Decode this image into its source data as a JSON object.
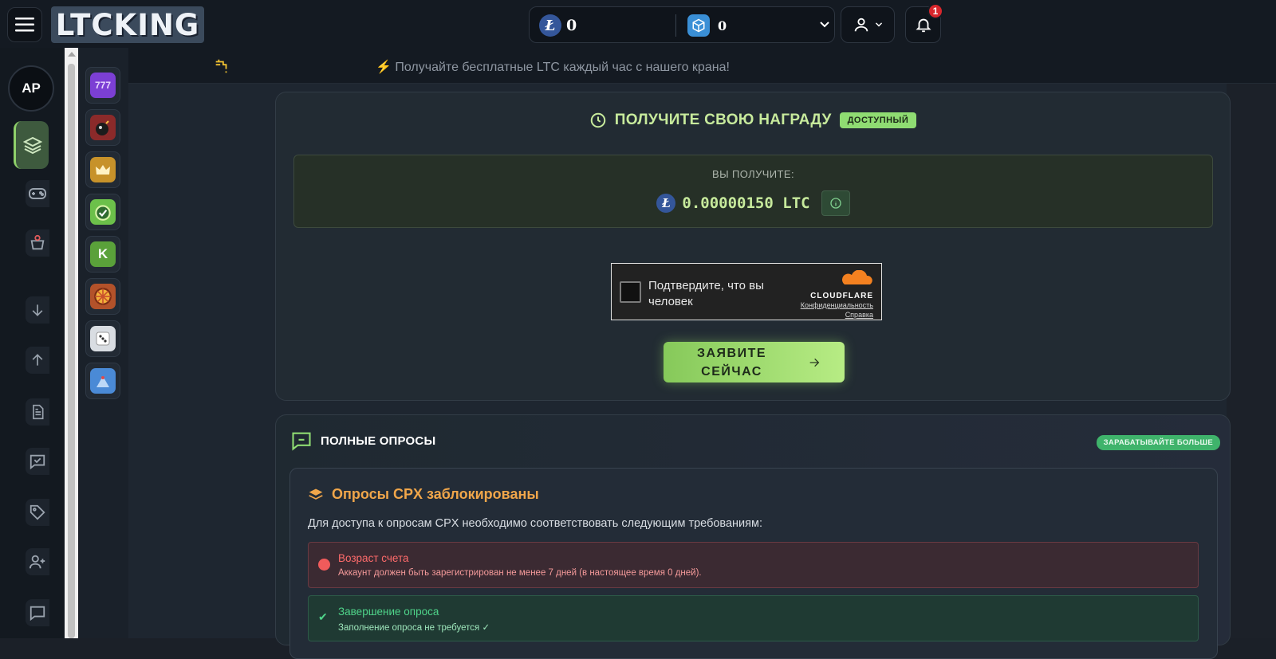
{
  "header": {
    "logo_text": "LTCKING",
    "ltc_balance": "0",
    "box_balance": "0",
    "notification_count": "1"
  },
  "sidebar": {
    "avatar_initials": "AP",
    "items": [
      "layers-icon",
      "gamepad-icon",
      "basket-icon",
      "deposit-icon",
      "withdraw-icon",
      "document-icon",
      "survey-icon",
      "tag-icon",
      "add-user-icon",
      "chat-icon"
    ]
  },
  "games": [
    {
      "name": "slots-777",
      "label": "777",
      "color": "#7c3fd4"
    },
    {
      "name": "mines",
      "label": "",
      "color": "#8b2a2a"
    },
    {
      "name": "towers",
      "label": "",
      "color": "#c7922a"
    },
    {
      "name": "timer",
      "label": "",
      "color": "#6cc04a"
    },
    {
      "name": "keno",
      "label": "K",
      "color": "#5aa13a"
    },
    {
      "name": "wheel",
      "label": "",
      "color": "#b3522a"
    },
    {
      "name": "dice",
      "label": "",
      "color": "#d9dde2"
    },
    {
      "name": "plinko",
      "label": "",
      "color": "#4a8ad6"
    }
  ],
  "ticker": {
    "text": "⚡ Получайте бесплатные LTC каждый час с нашего крана!"
  },
  "reward": {
    "title": "ПОЛУЧИТЕ СВОЮ НАГРАДУ",
    "status_badge": "ДОСТУПНЫЙ",
    "label": "ВЫ ПОЛУЧИТЕ:",
    "amount": "0.00000150 LTC"
  },
  "captcha": {
    "text": "Подтвердите, что вы человек",
    "brand": "CLOUDFLARE",
    "privacy_link": "Конфиденциальность",
    "help_link": "Справка"
  },
  "claim_button": {
    "label": "ЗАЯВИТЕ СЕЙЧАС"
  },
  "surveys": {
    "title": "ПОЛНЫЕ ОПРОСЫ",
    "earn_badge": "ЗАРАБАТЫВАЙТЕ БОЛЬШЕ",
    "locked_title": "Опросы CPX заблокированы",
    "description": "Для доступа к опросам CPX необходимо соответствовать следующим требованиям:",
    "requirements": [
      {
        "title": "Возраст счета",
        "detail": "Аккаунт должен быть зарегистрирован не менее 7 дней (в настоящее время 0 дней).",
        "met": false
      },
      {
        "title": "Завершение опроса",
        "detail": "Заполнение опроса не требуется ✓",
        "met": true
      }
    ]
  },
  "colors": {
    "accent_green": "#c7ea9c",
    "button_green": "#86c95a",
    "warning_orange": "#f0a64a",
    "error_red": "#ff6b6b",
    "success_green": "#4fd48a"
  }
}
